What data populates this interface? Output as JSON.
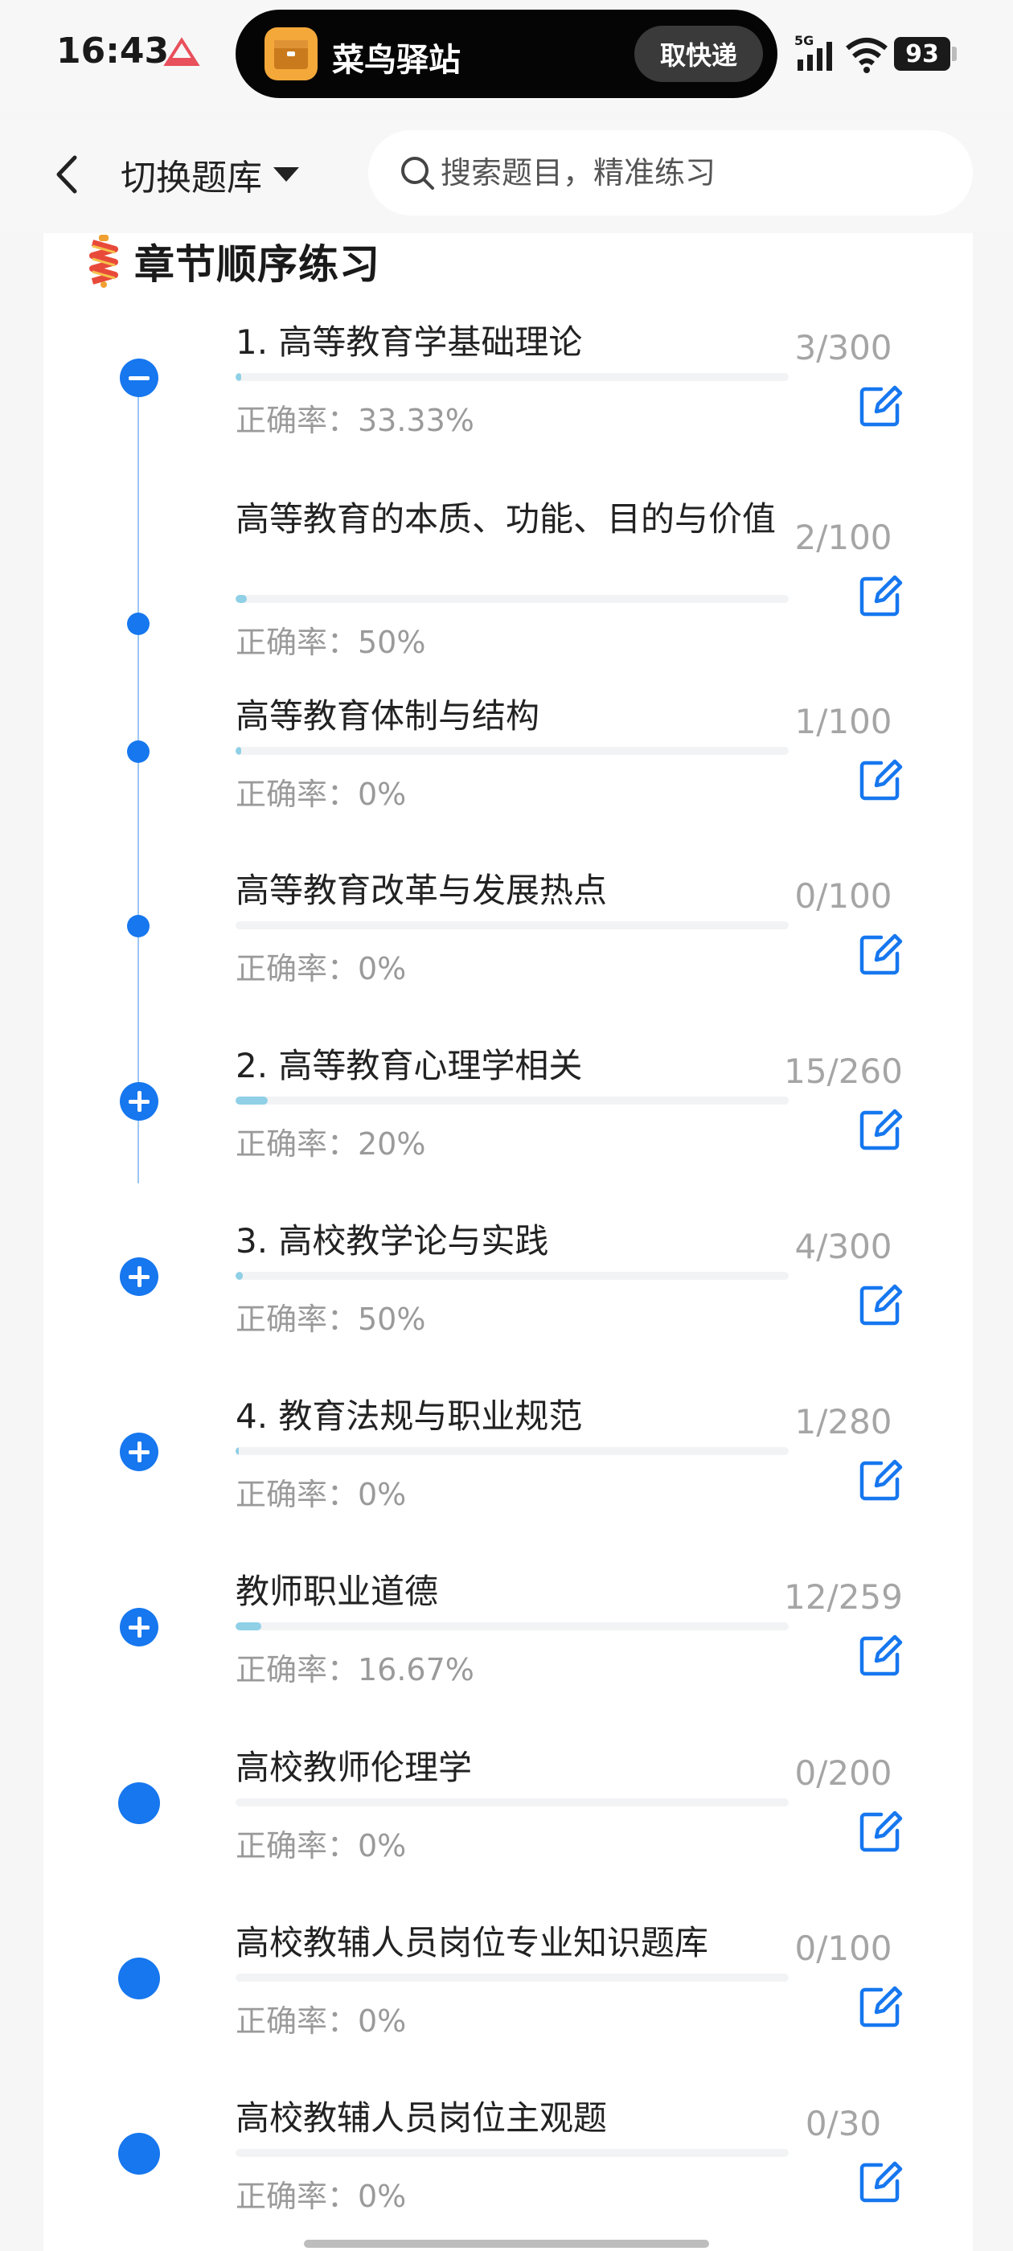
{
  "status_bar": {
    "time": "16:43",
    "island_app_name": "菜鸟驿站",
    "island_action": "取快递",
    "network": "5G",
    "battery": "93"
  },
  "nav": {
    "switch_label": "切换题库",
    "search_placeholder": "搜索题目，精准练习"
  },
  "section": {
    "title": "章节顺序练习"
  },
  "items": [
    {
      "title": "1. 高等教育学基础理论",
      "accuracy": "正确率：33.33%",
      "count": "3/300",
      "progress": 0.01,
      "marker": "minus"
    },
    {
      "title": "高等教育的本质、功能、目的与价值",
      "accuracy": "正确率：50%",
      "count": "2/100",
      "progress": 0.02,
      "marker": "dot"
    },
    {
      "title": "高等教育体制与结构",
      "accuracy": "正确率：0%",
      "count": "1/100",
      "progress": 0.01,
      "marker": "dot"
    },
    {
      "title": "高等教育改革与发展热点",
      "accuracy": "正确率：0%",
      "count": "0/100",
      "progress": 0.0,
      "marker": "dot"
    },
    {
      "title": "2. 高等教育心理学相关",
      "accuracy": "正确率：20%",
      "count": "15/260",
      "progress": 0.058,
      "marker": "plus"
    },
    {
      "title": "3. 高校教学论与实践",
      "accuracy": "正确率：50%",
      "count": "4/300",
      "progress": 0.013,
      "marker": "plus"
    },
    {
      "title": "4. 教育法规与职业规范",
      "accuracy": "正确率：0%",
      "count": "1/280",
      "progress": 0.004,
      "marker": "plus"
    },
    {
      "title": "教师职业道德",
      "accuracy": "正确率：16.67%",
      "count": "12/259",
      "progress": 0.046,
      "marker": "plus"
    },
    {
      "title": "高校教师伦理学",
      "accuracy": "正确率：0%",
      "count": "0/200",
      "progress": 0.0,
      "marker": "big"
    },
    {
      "title": "高校教辅人员岗位专业知识题库",
      "accuracy": "正确率：0%",
      "count": "0/100",
      "progress": 0.0,
      "marker": "big"
    },
    {
      "title": "高校教辅人员岗位主观题",
      "accuracy": "正确率：0%",
      "count": "0/30",
      "progress": 0.0,
      "marker": "big"
    }
  ],
  "colors": {
    "accent": "#1677ef",
    "progress_fill": "#8fd0e6",
    "muted_text": "#9a9a9a"
  }
}
